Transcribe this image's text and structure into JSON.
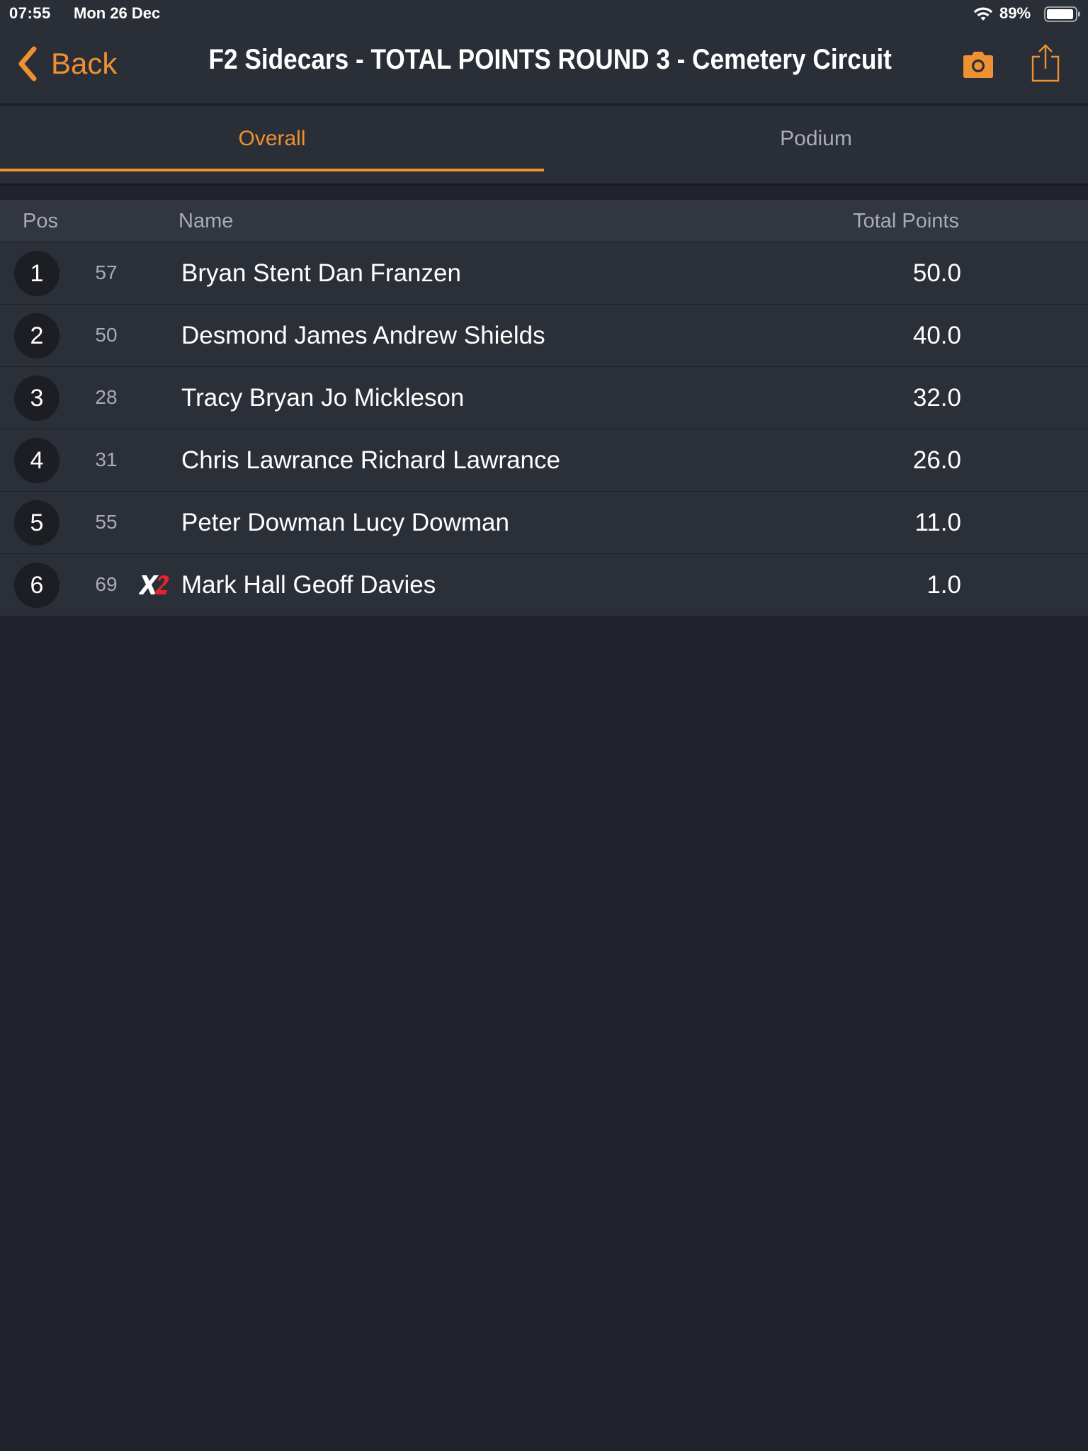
{
  "status_bar": {
    "time": "07:55",
    "date": "Mon 26 Dec",
    "battery": "89%"
  },
  "nav": {
    "back_label": "Back",
    "title": "F2 Sidecars - TOTAL POINTS ROUND 3 - Cemetery Circuit",
    "accent_color": "#ee9132"
  },
  "tabs": {
    "overall": "Overall",
    "podium": "Podium",
    "active": "Overall"
  },
  "table": {
    "headers": {
      "pos": "Pos",
      "name": "Name",
      "points": "Total Points"
    },
    "rows": [
      {
        "pos": "1",
        "number": "57",
        "name": "Bryan Stent Dan Franzen",
        "points": "50.0",
        "logo": ""
      },
      {
        "pos": "2",
        "number": "50",
        "name": "Desmond James Andrew Shields",
        "points": "40.0",
        "logo": ""
      },
      {
        "pos": "3",
        "number": "28",
        "name": "Tracy Bryan Jo Mickleson",
        "points": "32.0",
        "logo": ""
      },
      {
        "pos": "4",
        "number": "31",
        "name": "Chris Lawrance Richard Lawrance",
        "points": "26.0",
        "logo": ""
      },
      {
        "pos": "5",
        "number": "55",
        "name": "Peter Dowman Lucy Dowman",
        "points": "11.0",
        "logo": ""
      },
      {
        "pos": "6",
        "number": "69",
        "name": "Mark Hall Geoff Davies",
        "points": "1.0",
        "logo": "x2-logo"
      }
    ]
  }
}
